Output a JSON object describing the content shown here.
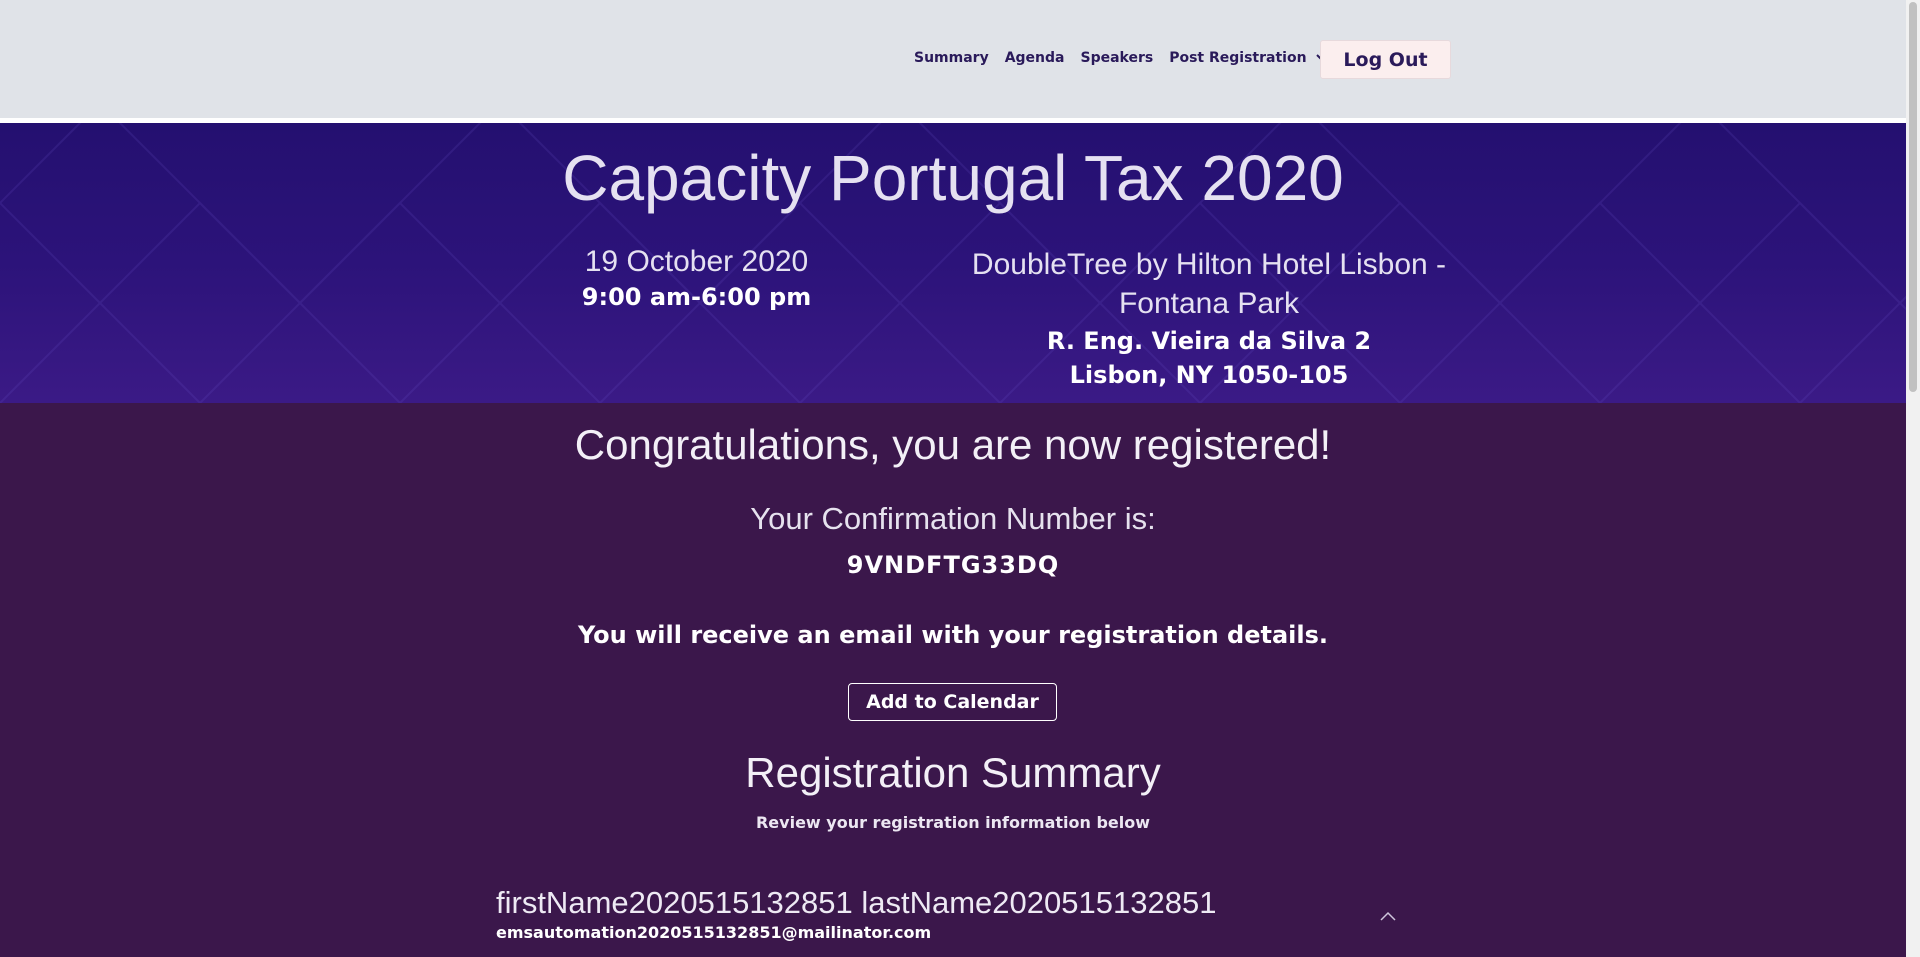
{
  "nav": {
    "items": [
      {
        "label": "Summary"
      },
      {
        "label": "Agenda"
      },
      {
        "label": "Speakers"
      },
      {
        "label": "Post Registration"
      }
    ],
    "logout_label": "Log Out"
  },
  "event": {
    "title": "Capacity Portugal Tax 2020",
    "date": "19 October 2020",
    "time": "9:00 am-6:00 pm",
    "venue_line1": "DoubleTree by Hilton Hotel Lisbon -",
    "venue_line2": "Fontana Park",
    "address_line1": "R. Eng. Vieira da Silva 2",
    "address_line2": "Lisbon, NY 1050-105"
  },
  "confirmation": {
    "heading": "Congratulations, you are now registered!",
    "label": "Your Confirmation Number is:",
    "number": "9VNDFTG33DQ",
    "email_note": "You will receive an email with your registration details.",
    "calendar_button": "Add to Calendar"
  },
  "summary": {
    "title": "Registration Summary",
    "subtitle": "Review your registration information below",
    "attendee_name": "firstName2020515132851 lastName2020515132851",
    "attendee_email": "emsautomation2020515132851@mailinator.com"
  },
  "colors": {
    "topbar": "#e0e3e8",
    "hero": "#2c137a",
    "body": "#3b174b",
    "nav_text": "#2a1a5a"
  }
}
